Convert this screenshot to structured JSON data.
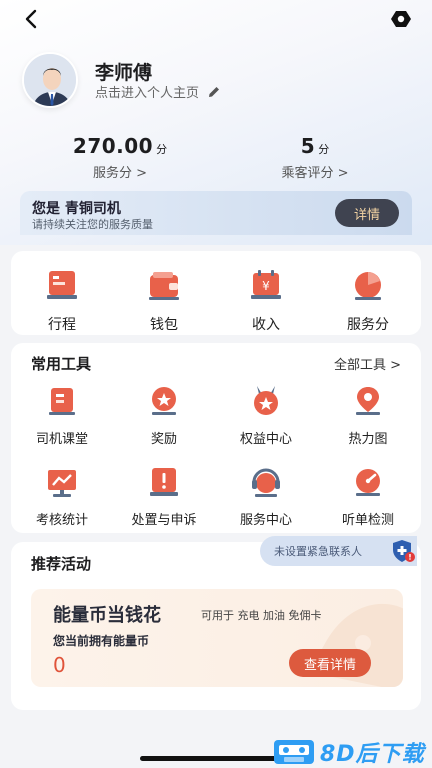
{
  "header": {
    "back_icon": "chevron-left-icon",
    "settings_icon": "hexagon-settings-icon"
  },
  "profile": {
    "name": "李师傅",
    "link_text": "点击进入个人主页",
    "edit_icon": "pencil-icon"
  },
  "stats": {
    "service_score": {
      "value": "270.00",
      "unit": "分",
      "label": "服务分 >"
    },
    "passenger_rating": {
      "value": "5",
      "unit": "分",
      "label": "乘客评分 >"
    }
  },
  "level": {
    "title": "您是 青铜司机",
    "subtitle": "请持续关注您的服务质量",
    "detail_label": "详情"
  },
  "quick_menu": [
    {
      "label": "行程",
      "icon": "trip-icon"
    },
    {
      "label": "钱包",
      "icon": "wallet-icon"
    },
    {
      "label": "收入",
      "icon": "income-icon"
    },
    {
      "label": "服务分",
      "icon": "service-score-icon"
    }
  ],
  "tools": {
    "title": "常用工具",
    "all_label": "全部工具 >",
    "items": [
      {
        "label": "司机课堂",
        "icon": "classroom-icon"
      },
      {
        "label": "奖励",
        "icon": "reward-icon"
      },
      {
        "label": "权益中心",
        "icon": "benefits-icon"
      },
      {
        "label": "热力图",
        "icon": "heatmap-icon"
      },
      {
        "label": "考核统计",
        "icon": "assessment-icon"
      },
      {
        "label": "处置与申诉",
        "icon": "appeal-icon"
      },
      {
        "label": "服务中心",
        "icon": "service-center-icon"
      },
      {
        "label": "听单检测",
        "icon": "order-check-icon"
      }
    ]
  },
  "activities": {
    "title": "推荐活动",
    "emergency_contact": "未设置紧急联系人",
    "energy": {
      "title": "能量币当钱花",
      "usage": "可用于 充电 加油 免佣卡",
      "balance_label": "您当前拥有能量币",
      "balance": "0",
      "button": "查看详情"
    }
  },
  "watermark": {
    "text": "8D后下载"
  },
  "colors": {
    "accent_red": "#dd5a3e",
    "dark_button": "#3f4350",
    "gold_text": "#f2d3a3",
    "watermark_blue": "#2e9df3"
  }
}
